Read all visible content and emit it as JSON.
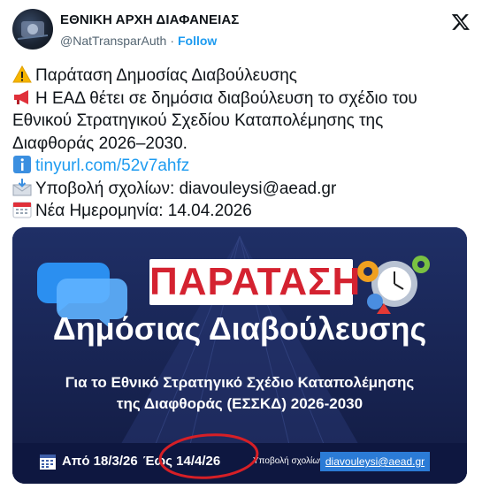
{
  "account": {
    "name": "ΕΘΝΙΚΗ ΑΡΧΗ ΔΙΑΦΑΝΕΙΑΣ",
    "handle": "@NatTransparAuth",
    "separator": "·",
    "follow_label": "Follow"
  },
  "tweet": {
    "line1": "Παράταση Δημοσίας Διαβούλευσης",
    "line2": "Η ΕΑΔ θέτει σε δημόσια διαβούλευση το σχέδιο του",
    "line3": "Εθνικού Στρατηγικού Σχεδίου Καταπολέμησης της",
    "line4": "Διαφθοράς 2026–2030.",
    "link": "tinyurl.com/52v7ahfz",
    "line6": "Υποβολή σχολίων: diavouleysi@aead.gr",
    "line7": "Νέα Ημερομηνία: 14.04.2026",
    "emoji": [
      "warning-icon",
      "megaphone-icon",
      "info-icon",
      "envelope-inbox-icon",
      "calendar-icon"
    ]
  },
  "banner": {
    "title": "ΠΑΡΑΤΑΣΗ",
    "subtitle": "Δημόσιας Διαβούλευσης",
    "desc_line1": "Για το Εθνικό Στρατηγικό Σχέδιο Καταπολέμησης",
    "desc_line2": "της Διαφθοράς (ΕΣΣΚΔ) 2026-2030",
    "date_from": "Από 18/3/26",
    "date_to": "Έως 14/4/26",
    "comments_label": "Υποβολή σχολίων:",
    "email": "diavouleysi@aead.gr",
    "colors": {
      "title_red": "#d42230",
      "navy": "#16214d",
      "email_bg": "#2b7bd6",
      "circle_red": "#d61f26"
    }
  }
}
